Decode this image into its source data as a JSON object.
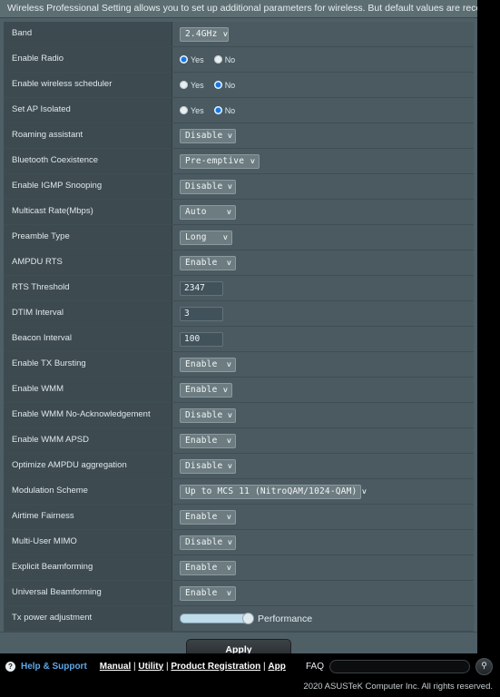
{
  "banner": {
    "text": "Wireless Professional Setting allows you to set up additional parameters for wireless. But default values are recommended."
  },
  "rows": [
    {
      "label": "Band",
      "type": "select",
      "value": "2.4GHz",
      "width": "w-band"
    },
    {
      "label": "Enable Radio",
      "type": "radio",
      "selected": "Yes",
      "yes": "Yes",
      "no": "No"
    },
    {
      "label": "Enable wireless scheduler",
      "type": "radio",
      "selected": "No",
      "yes": "Yes",
      "no": "No"
    },
    {
      "label": "Set AP Isolated",
      "type": "radio",
      "selected": "No",
      "yes": "Yes",
      "no": "No"
    },
    {
      "label": "Roaming assistant",
      "type": "select",
      "value": "Disable",
      "width": "w-md"
    },
    {
      "label": "Bluetooth Coexistence",
      "type": "select",
      "value": "Pre-emptive",
      "width": "w-xl"
    },
    {
      "label": "Enable IGMP Snooping",
      "type": "select",
      "value": "Disable",
      "width": "w-md"
    },
    {
      "label": "Multicast Rate(Mbps)",
      "type": "select",
      "value": "Auto",
      "width": "w-md"
    },
    {
      "label": "Preamble Type",
      "type": "select",
      "value": "Long",
      "width": "w-sm"
    },
    {
      "label": "AMPDU RTS",
      "type": "select",
      "value": "Enable",
      "width": "w-md"
    },
    {
      "label": "RTS Threshold",
      "type": "text",
      "value": "2347"
    },
    {
      "label": "DTIM Interval",
      "type": "text",
      "value": "3"
    },
    {
      "label": "Beacon Interval",
      "type": "text",
      "value": "100"
    },
    {
      "label": "Enable TX Bursting",
      "type": "select",
      "value": "Enable",
      "width": "w-md"
    },
    {
      "label": "Enable WMM",
      "type": "select",
      "value": "Enable",
      "width": "w-sm"
    },
    {
      "label": "Enable WMM No-Acknowledgement",
      "type": "select",
      "value": "Disable",
      "width": "w-md"
    },
    {
      "label": "Enable WMM APSD",
      "type": "select",
      "value": "Enable",
      "width": "w-md"
    },
    {
      "label": "Optimize AMPDU aggregation",
      "type": "select",
      "value": "Disable",
      "width": "w-md"
    },
    {
      "label": "Modulation Scheme",
      "type": "select",
      "value": "Up to MCS 11 (NitroQAM/1024-QAM)",
      "width": "w-xxl"
    },
    {
      "label": "Airtime Fairness",
      "type": "select",
      "value": "Enable",
      "width": "w-md"
    },
    {
      "label": "Multi-User MIMO",
      "type": "select",
      "value": "Disable",
      "width": "w-md"
    },
    {
      "label": "Explicit Beamforming",
      "type": "select",
      "value": "Enable",
      "width": "w-md"
    },
    {
      "label": "Universal Beamforming",
      "type": "select",
      "value": "Enable",
      "width": "w-md"
    },
    {
      "label": "Tx power adjustment",
      "type": "slider",
      "value": "Performance",
      "percent": 100
    }
  ],
  "apply": {
    "label": "Apply"
  },
  "footer": {
    "help_icon": "?",
    "help_label": "Help & Support",
    "links": [
      "Manual",
      "Utility",
      "Product Registration",
      "App"
    ],
    "separator": "|",
    "faq_label": "FAQ",
    "faq_placeholder": "",
    "faq_value": "",
    "search_icon": "⚲",
    "copyright": "2020 ASUSTeK Computer Inc. All rights reserved."
  },
  "colors": {
    "panel_bg": "#4a5a60",
    "label_bg": "#3d4a50",
    "banner_bg": "#5d6e73",
    "radio_on": "#1278e8",
    "help_link": "#5fa8e8",
    "slider_fill": "#bfdcea"
  }
}
